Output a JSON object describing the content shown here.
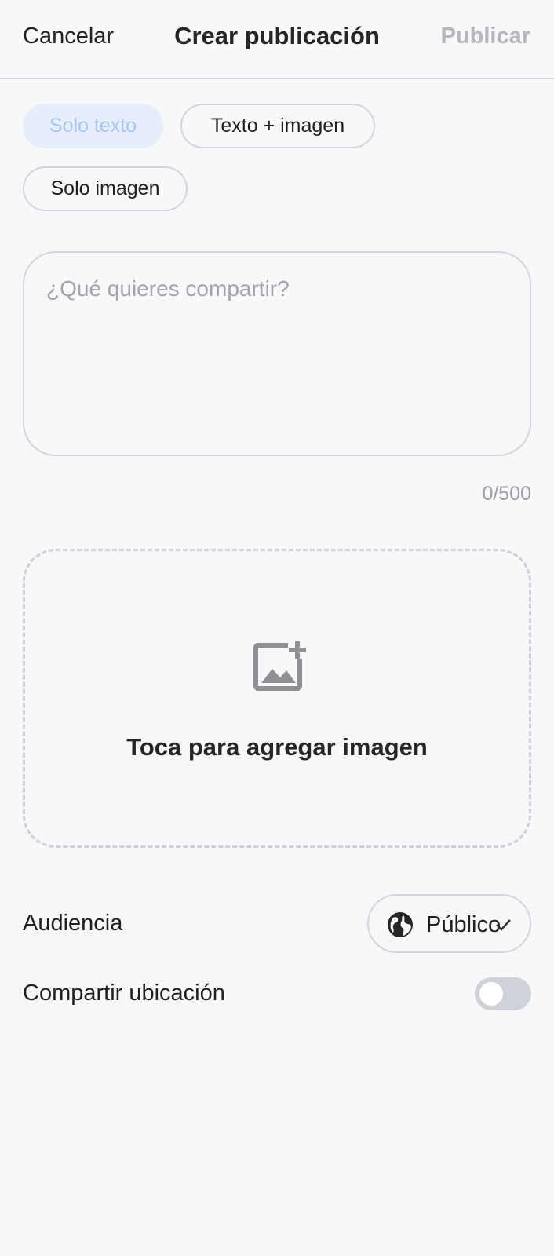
{
  "header": {
    "cancel_label": "Cancelar",
    "title": "Crear publicación",
    "publish_label": "Publicar"
  },
  "post_types": {
    "options": [
      {
        "label": "Solo texto",
        "selected": true
      },
      {
        "label": "Texto + imagen",
        "selected": false
      },
      {
        "label": "Solo imagen",
        "selected": false
      }
    ]
  },
  "composer": {
    "placeholder": "¿Qué quieres compartir?",
    "value": "",
    "counter": "0/500"
  },
  "image_picker": {
    "icon": "add-image-icon",
    "label": "Toca para agregar imagen"
  },
  "audience": {
    "label": "Audiencia",
    "value": "Público",
    "icon": "globe-icon"
  },
  "location": {
    "label": "Compartir ubicación",
    "enabled": false
  },
  "colors": {
    "background": "#f7f8fa",
    "active_chip_bg": "#e6eefb",
    "active_chip_text": "#a9c6ee",
    "disabled_text": "#b6b7ba",
    "toggle_off": "#cfd2d8"
  }
}
